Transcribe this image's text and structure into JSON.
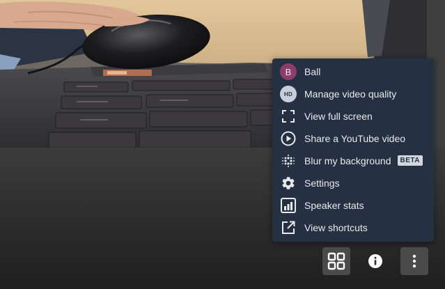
{
  "menu": {
    "items": [
      {
        "label": "Ball",
        "icon": "avatar",
        "avatar_initial": "B"
      },
      {
        "label": "Manage video quality",
        "icon": "hd-icon",
        "icon_text": "HD"
      },
      {
        "label": "View full screen",
        "icon": "fullscreen-icon"
      },
      {
        "label": "Share a YouTube video",
        "icon": "play-circle-icon"
      },
      {
        "label": "Blur my background",
        "icon": "blur-dots-icon",
        "badge": "BETA"
      },
      {
        "label": "Settings",
        "icon": "gear-icon"
      },
      {
        "label": "Speaker stats",
        "icon": "bar-chart-icon"
      },
      {
        "label": "View shortcuts",
        "icon": "open-external-icon"
      }
    ]
  },
  "toolbar": {
    "buttons": [
      {
        "name": "tile-view",
        "icon": "grid-icon"
      },
      {
        "name": "meeting-info",
        "icon": "info-icon"
      },
      {
        "name": "more-actions",
        "icon": "more-vertical-icon"
      }
    ]
  },
  "colors": {
    "menu_bg": "#253043",
    "menu_text": "#e8eaed",
    "avatar_bg": "#8e3d6a",
    "toolbar_button_bg": "#4a4a4a"
  }
}
